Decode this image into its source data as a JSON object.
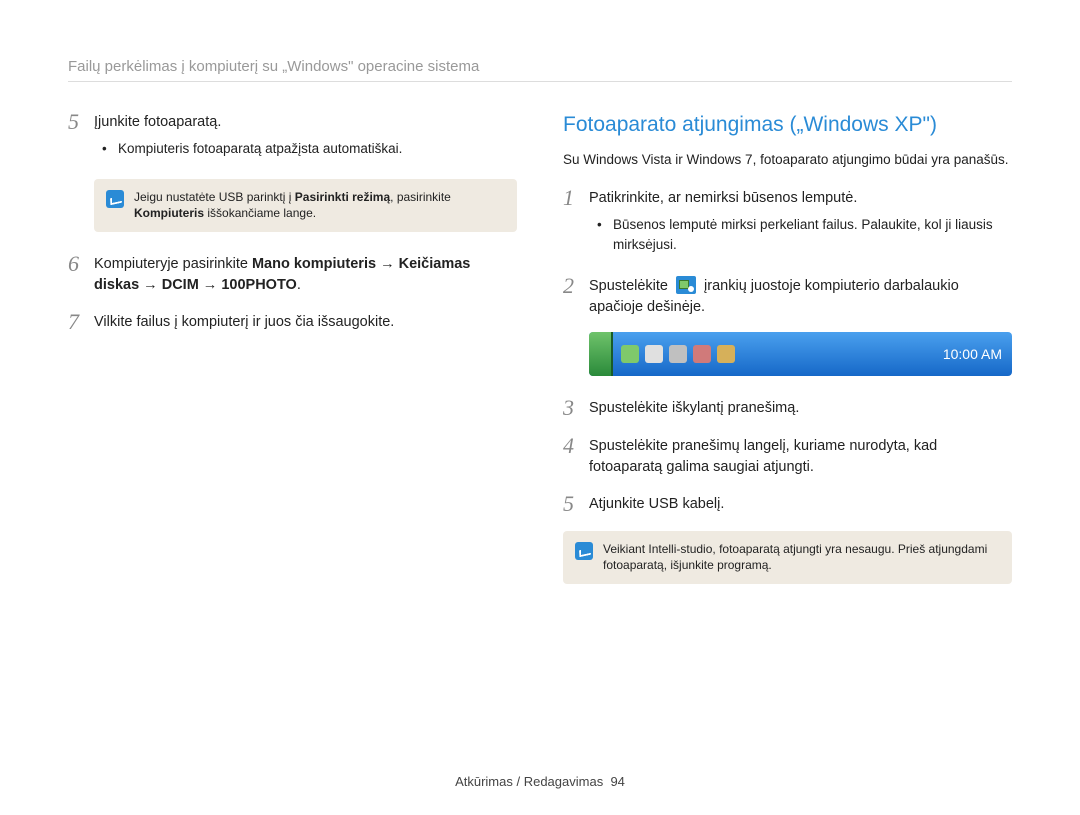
{
  "breadcrumb": "Failų perkėlimas į kompiuterį su „Windows\" operacine sistema",
  "left": {
    "step5": {
      "num": "5",
      "text": "Įjunkite fotoaparatą."
    },
    "step5_bullet": "Kompiuteris fotoaparatą atpažįsta automatiškai.",
    "note1_a": "Jeigu nustatėte USB parinktį į ",
    "note1_b": "Pasirinkti režimą",
    "note1_c": ", pasirinkite ",
    "note1_d": "Kompiuteris",
    "note1_e": " iššokančiame lange.",
    "step6": {
      "num": "6",
      "a": "Kompiuteryje pasirinkite ",
      "b": "Mano kompiuteris",
      "arrow1": " → ",
      "c": "Keičiamas diskas",
      "arrow2": " → ",
      "d": "DCIM",
      "arrow3": " → ",
      "e": "100PHOTO",
      "dot": "."
    },
    "step7": {
      "num": "7",
      "text": "Vilkite failus į kompiuterį ir juos čia išsaugokite."
    }
  },
  "right": {
    "title": "Fotoaparato atjungimas („Windows XP\")",
    "intro": "Su Windows Vista ir Windows 7, fotoaparato atjungimo būdai yra panašūs.",
    "step1": {
      "num": "1",
      "text": "Patikrinkite, ar nemirksi būsenos lemputė."
    },
    "step1_bullet": "Būsenos lemputė mirksi perkeliant failus. Palaukite, kol ji liausis mirksėjusi.",
    "step2": {
      "num": "2",
      "a": "Spustelėkite ",
      "b": " įrankių juostoje kompiuterio darbalaukio apačioje dešinėje."
    },
    "clock": "10:00 AM",
    "step3": {
      "num": "3",
      "text": "Spustelėkite iškylantį pranešimą."
    },
    "step4": {
      "num": "4",
      "text": "Spustelėkite pranešimų langelį, kuriame nurodyta, kad fotoaparatą galima saugiai atjungti."
    },
    "step5": {
      "num": "5",
      "text": "Atjunkite USB kabelį."
    },
    "note2": "Veikiant Intelli-studio, fotoaparatą atjungti yra nesaugu. Prieš atjungdami fotoaparatą, išjunkite programą."
  },
  "footer": {
    "section": "Atkūrimas / Redagavimas",
    "page": "94"
  }
}
